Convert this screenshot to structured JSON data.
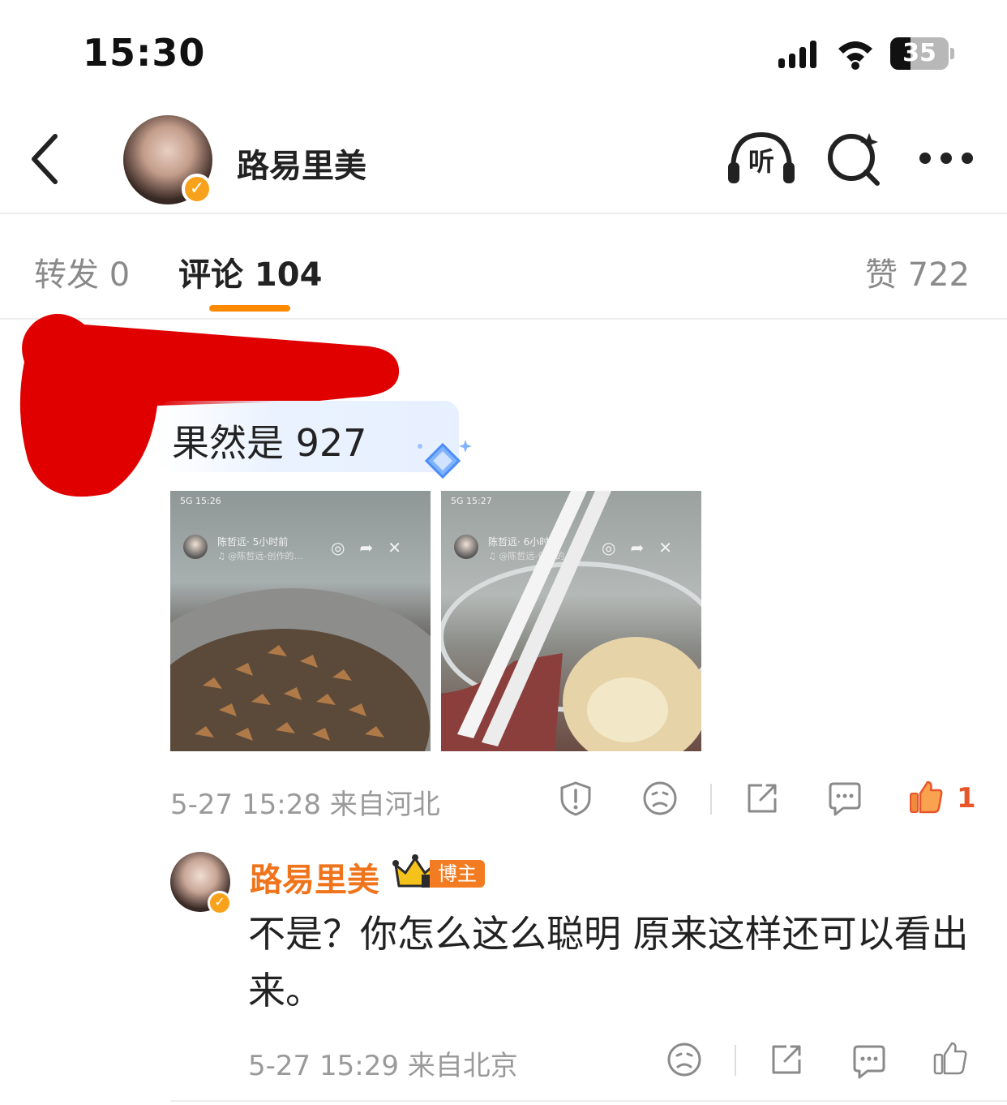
{
  "status_bar": {
    "time": "15:30",
    "battery_level": "35",
    "battery_fraction": 0.35
  },
  "header": {
    "title": "路易里美",
    "listen_label": "听"
  },
  "tabs": {
    "repost": "转发 0",
    "comments": "评论 104",
    "likes": "赞 722"
  },
  "comment": {
    "text": "果然是 927",
    "meta": "5-27 15:28 来自河北",
    "like_count": "1",
    "photos": [
      {
        "status": "5G 15:26",
        "caption": "陈哲远· 5小时前",
        "sub": "♫ @陈哲远-创作的…"
      },
      {
        "status": "5G 15:27",
        "caption": "陈哲远· 6小时前",
        "sub": "♫ @陈哲远-创作的…"
      }
    ]
  },
  "reply": {
    "username": "路易里美",
    "badge": "博主",
    "text": "不是？你怎么这么聪明 原来这样还可以看出来。",
    "meta": "5-27 15:29 来自北京"
  },
  "colors": {
    "accent": "#ff8a00",
    "username": "#f0741b",
    "like": "#e8552a",
    "badge_verified": "#f7a21a"
  }
}
